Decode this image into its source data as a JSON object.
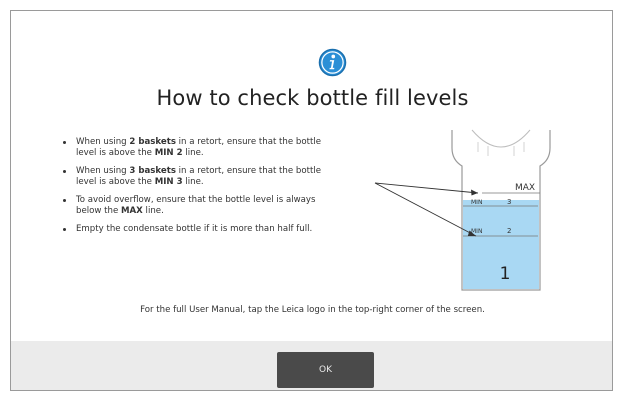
{
  "dialog": {
    "title": "How to check bottle fill levels",
    "icon": "info-icon",
    "bullets": [
      {
        "pre": "When using ",
        "bold1": "2 baskets",
        "mid": " in a retort, ensure that the bottle level is above the ",
        "bold2": "MIN 2",
        "post": " line."
      },
      {
        "pre": "When using ",
        "bold1": "3 baskets",
        "mid": " in a retort, ensure that the bottle level is above the ",
        "bold2": "MIN 3",
        "post": " line."
      },
      {
        "pre": "To avoid overflow, ensure that the bottle level is always below the ",
        "bold1": "MAX",
        "mid": " line.",
        "bold2": "",
        "post": ""
      },
      {
        "pre": "Empty the condensate bottle if it is more than half full.",
        "bold1": "",
        "mid": "",
        "bold2": "",
        "post": ""
      }
    ],
    "illustration": {
      "max_label": "MAX",
      "min3_label": "MIN",
      "min3_num": "3",
      "min2_label": "MIN",
      "min2_num": "2",
      "bottle_number": "1",
      "fill_color": "#a9d8f3"
    },
    "footer_note": "For the full User Manual, tap the Leica logo in the top-right corner of the screen.",
    "ok_label": "OK"
  },
  "colors": {
    "icon_blue": "#2b8fd6",
    "button_bg": "#4a4a4a",
    "bar_bg": "#ebebeb"
  }
}
